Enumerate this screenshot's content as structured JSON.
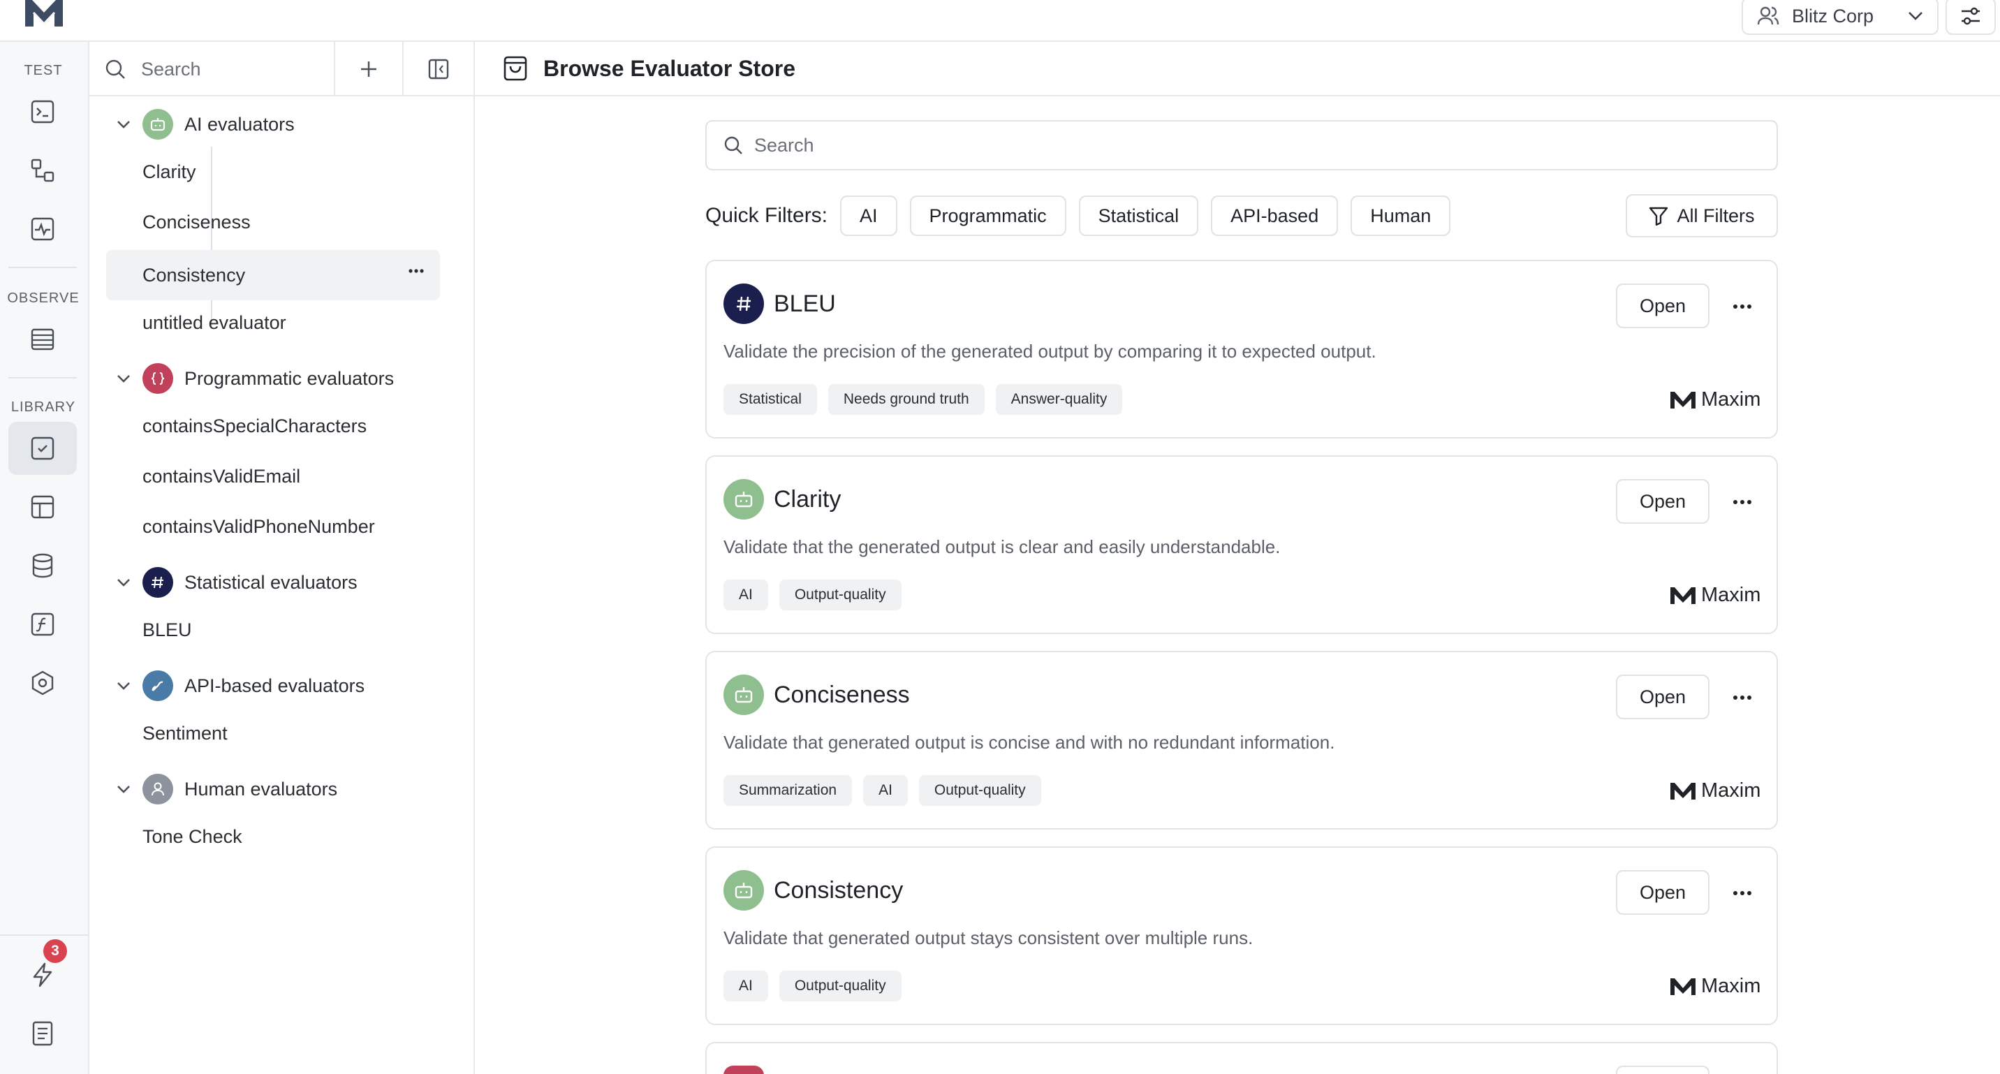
{
  "app": {
    "logo": "maxim-logo"
  },
  "workspace": {
    "name": "Blitz Corp",
    "icon": "users-icon"
  },
  "rail": {
    "sections": [
      "TEST",
      "OBSERVE",
      "LIBRARY"
    ],
    "notification_count": "3"
  },
  "tree": {
    "search_placeholder": "Search",
    "groups": [
      {
        "label": "AI evaluators",
        "color": "#8fbf8e",
        "children": [
          "Clarity",
          "Conciseness",
          "Consistency",
          "untitled evaluator"
        ]
      },
      {
        "label": "Programmatic evaluators",
        "color": "#c2415a",
        "children": [
          "containsSpecialCharacters",
          "containsValidEmail",
          "containsValidPhoneNumber"
        ]
      },
      {
        "label": "Statistical evaluators",
        "color": "#1a1f4d",
        "children": [
          "BLEU"
        ]
      },
      {
        "label": "API-based evaluators",
        "color": "#4a7ba6",
        "children": [
          "Sentiment"
        ]
      },
      {
        "label": "Human evaluators",
        "color": "#8d939c",
        "children": [
          "Tone Check"
        ]
      }
    ],
    "selected": "Consistency"
  },
  "main": {
    "title": "Browse Evaluator Store",
    "search_placeholder": "Search",
    "quick_filters_label": "Quick Filters:",
    "quick_filters": [
      "AI",
      "Programmatic",
      "Statistical",
      "API-based",
      "Human"
    ],
    "all_filters_label": "All Filters",
    "open_label": "Open",
    "brand_label": "Maxim",
    "cards": [
      {
        "title": "BLEU",
        "icon": "hash-icon",
        "color": "#1a1f4d",
        "description": "Validate the precision of the generated output by comparing it to expected output.",
        "tags": [
          "Statistical",
          "Needs ground truth",
          "Answer-quality"
        ]
      },
      {
        "title": "Clarity",
        "icon": "robot-icon",
        "color": "#8fbf8e",
        "description": "Validate that the generated output is clear and easily understandable.",
        "tags": [
          "AI",
          "Output-quality"
        ]
      },
      {
        "title": "Conciseness",
        "icon": "robot-icon",
        "color": "#8fbf8e",
        "description": "Validate that generated output is concise and with no redundant information.",
        "tags": [
          "Summarization",
          "AI",
          "Output-quality"
        ]
      },
      {
        "title": "Consistency",
        "icon": "robot-icon",
        "color": "#8fbf8e",
        "description": "Validate that generated output stays consistent over multiple runs.",
        "tags": [
          "AI",
          "Output-quality"
        ]
      }
    ]
  }
}
